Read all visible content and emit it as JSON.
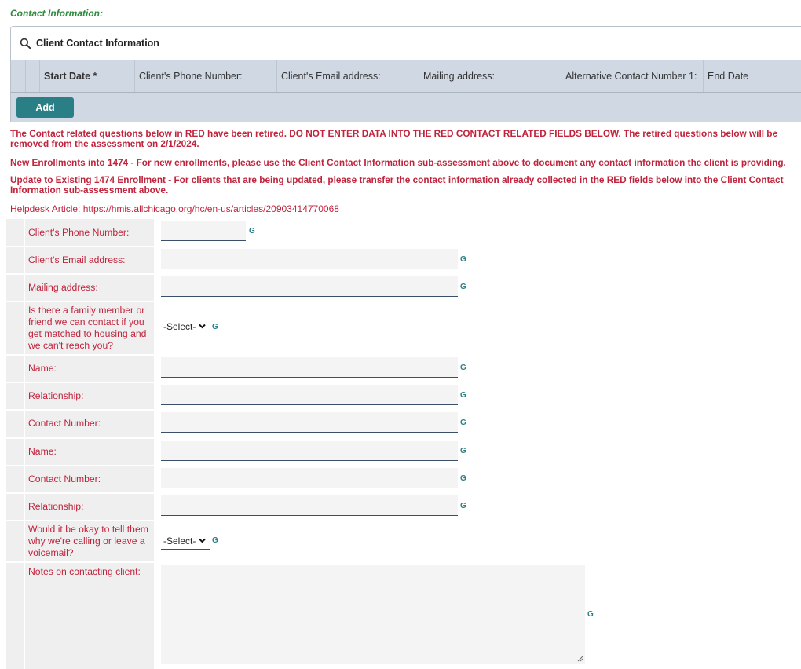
{
  "section_title": "Contact Information:",
  "sub_assessment": {
    "title": "Client Contact Information",
    "icon": "search-icon",
    "columns": [
      "Start Date *",
      "Client's Phone Number:",
      "Client's Email address:",
      "Mailing address:",
      "Alternative Contact Number 1:",
      "End Date"
    ],
    "add_label": "Add"
  },
  "notices": [
    "The Contact related questions below in RED have been retired. DO NOT ENTER DATA INTO THE RED CONTACT RELATED FIELDS BELOW. The retired questions below will be removed from the assessment on 2/1/2024.",
    "New Enrollments into 1474 - For new enrollments, please use the Client Contact Information sub-assessment above to document any contact information the client is providing.",
    "Update to Existing 1474 Enrollment - For clients that are being updated, please transfer the contact information already collected in the RED fields below into the Client Contact Information sub-assessment above."
  ],
  "helpdesk": "Helpdesk Article: https://hmis.allchicago.org/hc/en-us/articles/20903414770068",
  "g_label": "G",
  "select_default": "-Select-",
  "colors": {
    "retired_red": "#c0243c",
    "teal": "#2a7f86",
    "section_green": "#2e8b3a",
    "grid_bg": "#cfd8e3"
  },
  "fields": [
    {
      "label": "Client's Phone Number:",
      "type": "text",
      "value": ""
    },
    {
      "label": "Client's Email address:",
      "type": "text",
      "value": ""
    },
    {
      "label": "Mailing address:",
      "type": "text",
      "value": ""
    },
    {
      "label": "Is there a family member or friend we can contact if you get matched to housing and we can't reach you?",
      "type": "select",
      "value": "-Select-"
    },
    {
      "label": "Name:",
      "type": "text",
      "value": ""
    },
    {
      "label": "Relationship:",
      "type": "text",
      "value": ""
    },
    {
      "label": "Contact Number:",
      "type": "text",
      "value": ""
    },
    {
      "label": "Name:",
      "type": "text",
      "value": ""
    },
    {
      "label": "Contact Number:",
      "type": "text",
      "value": ""
    },
    {
      "label": "Relationship:",
      "type": "text",
      "value": ""
    },
    {
      "label": "Would it be okay to tell them why we're calling or leave a voicemail?",
      "type": "select",
      "value": "-Select-"
    },
    {
      "label": "Notes on contacting client:",
      "type": "textarea",
      "value": ""
    }
  ]
}
